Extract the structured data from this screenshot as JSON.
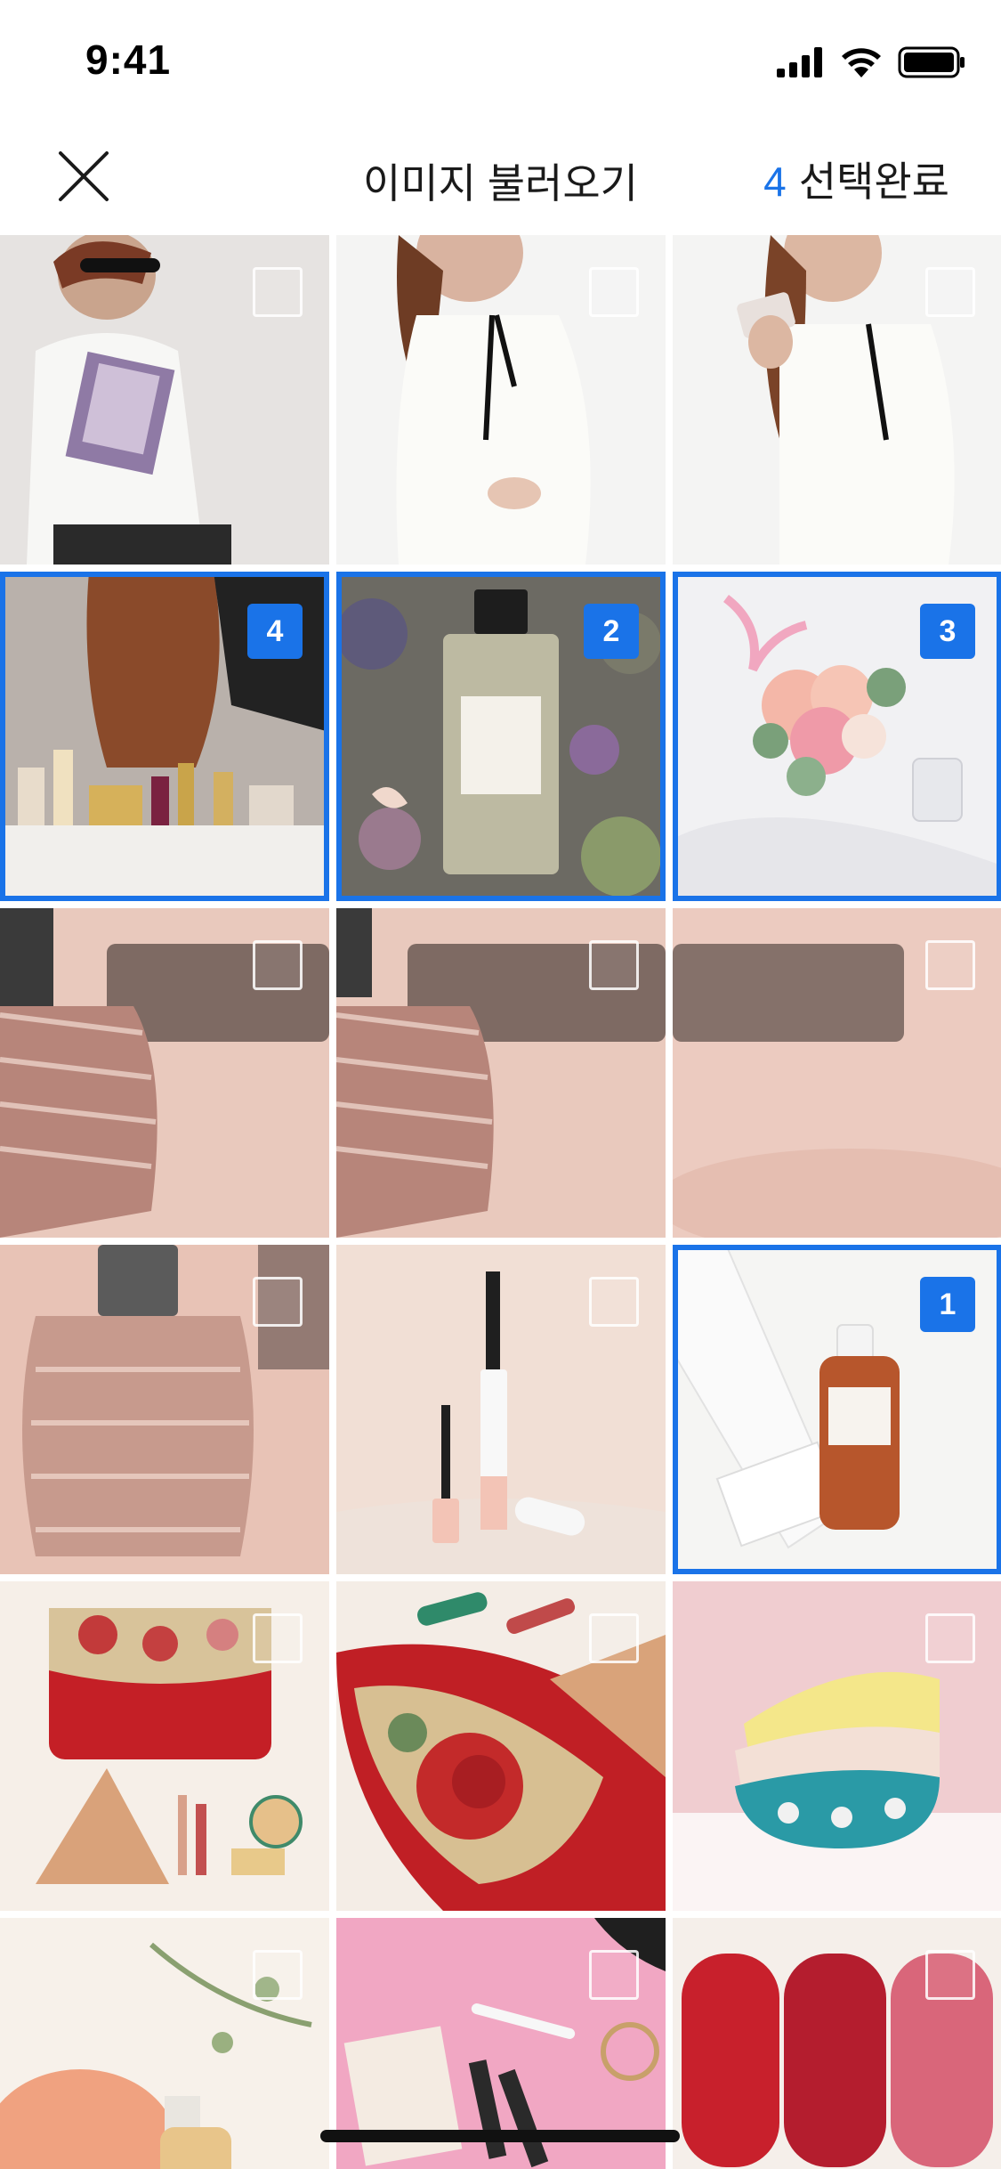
{
  "status_bar": {
    "time": "9:41"
  },
  "nav": {
    "title": "이미지 불러오기",
    "selected_count": "4",
    "done_label": "선택완료",
    "close_icon": "close-x-icon"
  },
  "colors": {
    "accent": "#1a73e8"
  },
  "photos": [
    {
      "subject": "woman-with-sunglasses-and-magazine",
      "selected": false,
      "order": ""
    },
    {
      "subject": "woman-in-white-blouse",
      "selected": false,
      "order": ""
    },
    {
      "subject": "woman-holding-phone",
      "selected": false,
      "order": ""
    },
    {
      "subject": "vanity-with-perfume-bottles",
      "selected": true,
      "order": "4"
    },
    {
      "subject": "perfume-bottle-with-petals",
      "selected": true,
      "order": "2"
    },
    {
      "subject": "flower-bouquet-on-bed",
      "selected": true,
      "order": "3"
    },
    {
      "subject": "glass-perfume-bottle-closeup",
      "selected": false,
      "order": ""
    },
    {
      "subject": "glass-perfume-bottle-closeup",
      "selected": false,
      "order": ""
    },
    {
      "subject": "blurred-pink-background",
      "selected": false,
      "order": ""
    },
    {
      "subject": "glass-perfume-bottle",
      "selected": false,
      "order": ""
    },
    {
      "subject": "mascara-on-pink",
      "selected": false,
      "order": ""
    },
    {
      "subject": "body-oil-bottle",
      "selected": true,
      "order": "1"
    },
    {
      "subject": "red-clutch-and-cosmetics",
      "selected": false,
      "order": ""
    },
    {
      "subject": "red-clutch-with-rose",
      "selected": false,
      "order": ""
    },
    {
      "subject": "stacked-bowls",
      "selected": false,
      "order": ""
    },
    {
      "subject": "sponge-and-serum",
      "selected": false,
      "order": ""
    },
    {
      "subject": "makeup-flatlay-pink",
      "selected": false,
      "order": ""
    },
    {
      "subject": "lipstick-swatches",
      "selected": false,
      "order": ""
    }
  ]
}
